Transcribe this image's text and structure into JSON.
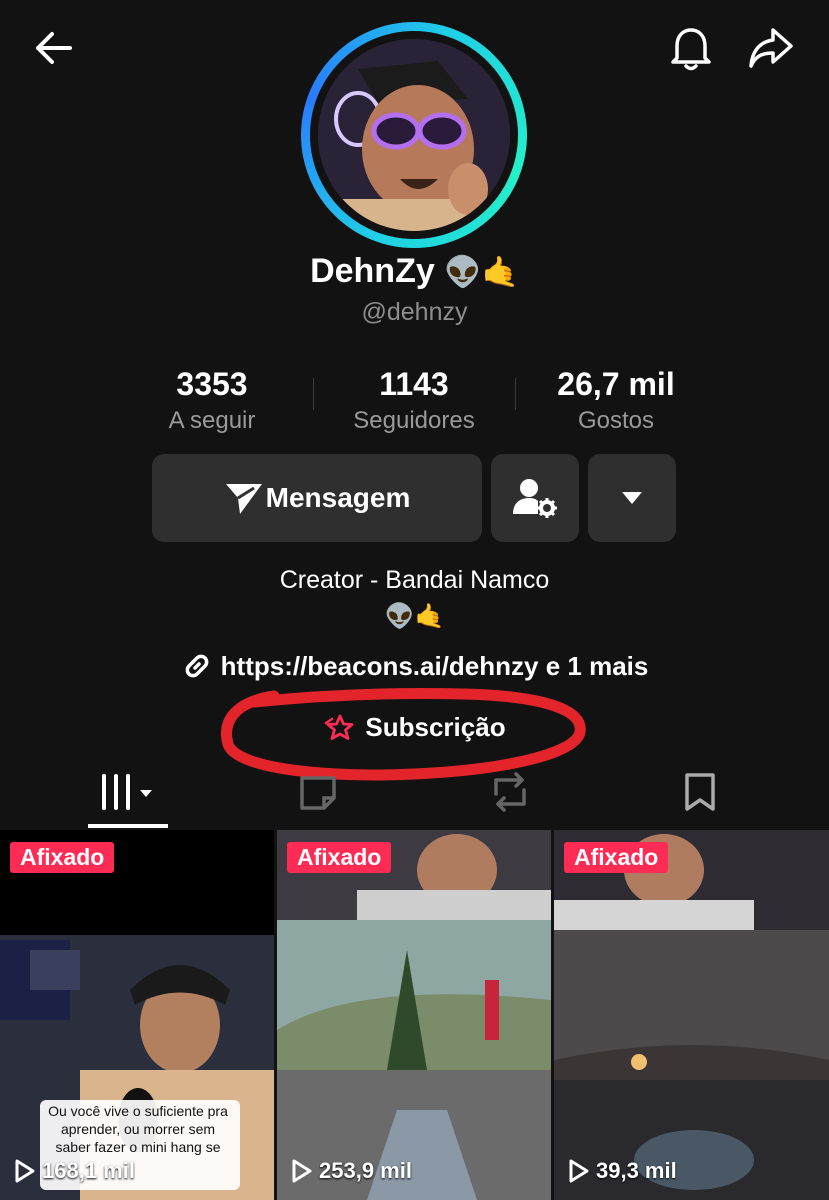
{
  "header": {
    "back_icon": "arrow-left-icon",
    "bell_icon": "bell-icon",
    "share_icon": "share-arrow-icon"
  },
  "profile": {
    "display_name": "DehnZy",
    "name_emojis": "👽🤙",
    "handle": "@dehnzy"
  },
  "stats": [
    {
      "value": "3353",
      "label": "A seguir"
    },
    {
      "value": "1143",
      "label": "Seguidores"
    },
    {
      "value": "26,7 mil",
      "label": "Gostos"
    }
  ],
  "actions": {
    "message_label": "Mensagem",
    "message_icon": "send-icon",
    "friends_icon": "user-settings-icon",
    "more_icon": "caret-down-icon"
  },
  "bio": {
    "line1": "Creator - Bandai Namco",
    "line2": "👽🤙",
    "link": "https://beacons.ai/dehnzy e 1 mais",
    "link_icon": "link-icon",
    "subscription_label": "Subscrição",
    "subscription_icon": "star-icon"
  },
  "tabs": [
    {
      "name": "videos",
      "icon": "grid-icon",
      "active": true
    },
    {
      "name": "private",
      "icon": "lock-doc-icon",
      "active": false
    },
    {
      "name": "reposts",
      "icon": "repost-icon",
      "active": false
    },
    {
      "name": "saved",
      "icon": "bookmark-icon",
      "active": false
    }
  ],
  "videos": [
    {
      "badge": "Afixado",
      "views": "168,1 mil",
      "caption": "Ou você vive o suficiente pra aprender, ou morrer sem saber fazer o mini hang se"
    },
    {
      "badge": "Afixado",
      "views": "253,9 mil"
    },
    {
      "badge": "Afixado",
      "views": "39,3 mil"
    }
  ],
  "colors": {
    "background": "#121212",
    "badge": "#fe2c55",
    "ring": "#1fd0e6",
    "annotation": "#e3242b"
  }
}
